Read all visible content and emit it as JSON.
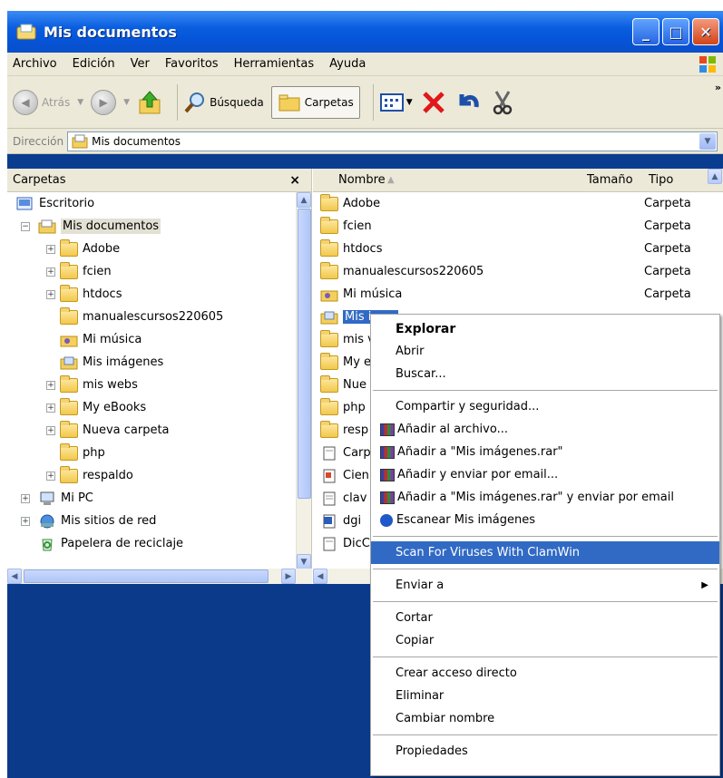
{
  "window": {
    "title": "Mis documentos"
  },
  "menu": [
    "Archivo",
    "Edición",
    "Ver",
    "Favoritos",
    "Herramientas",
    "Ayuda"
  ],
  "toolbar": {
    "back": "Atrás",
    "search": "Búsqueda",
    "folders": "Carpetas"
  },
  "address": {
    "label": "Dirección",
    "value": "Mis documentos"
  },
  "folders_pane": {
    "title": "Carpetas",
    "close": "×",
    "tree": [
      {
        "label": "Escritorio"
      },
      {
        "label": "Mis documentos"
      },
      {
        "label": "Adobe"
      },
      {
        "label": "fcien"
      },
      {
        "label": "htdocs"
      },
      {
        "label": "manualescursos220605"
      },
      {
        "label": "Mi música"
      },
      {
        "label": "Mis imágenes"
      },
      {
        "label": "mis webs"
      },
      {
        "label": "My eBooks"
      },
      {
        "label": "Nueva carpeta"
      },
      {
        "label": "php"
      },
      {
        "label": "respaldo"
      },
      {
        "label": "Mi PC"
      },
      {
        "label": "Mis sitios de red"
      },
      {
        "label": "Papelera de reciclaje"
      }
    ]
  },
  "files": {
    "columns": {
      "name": "Nombre",
      "size": "Tamaño",
      "type": "Tipo"
    },
    "rows": [
      {
        "name": "Adobe",
        "type": "Carpeta"
      },
      {
        "name": "fcien",
        "type": "Carpeta"
      },
      {
        "name": "htdocs",
        "type": "Carpeta"
      },
      {
        "name": "manualescursos220605",
        "type": "Carpeta"
      },
      {
        "name": "Mi música",
        "type": "Carpeta"
      },
      {
        "name": "Mis i",
        "type": ""
      },
      {
        "name": "mis v",
        "type": ""
      },
      {
        "name": "My e",
        "type": ""
      },
      {
        "name": "Nue",
        "type": ""
      },
      {
        "name": "php",
        "type": ""
      },
      {
        "name": "resp",
        "type": ""
      },
      {
        "name": "Carp",
        "type": ""
      },
      {
        "name": "Cien",
        "type": ""
      },
      {
        "name": "clav",
        "type": ""
      },
      {
        "name": "dgi",
        "type": ""
      },
      {
        "name": "DicC",
        "type": ""
      }
    ]
  },
  "context_menu": {
    "explore": "Explorar",
    "open": "Abrir",
    "search": "Buscar...",
    "share": "Compartir y seguridad...",
    "add_archive": "Añadir al archivo...",
    "add_rar": "Añadir a \"Mis imágenes.rar\"",
    "add_email": "Añadir y enviar por email...",
    "add_rar_email": "Añadir a \"Mis imágenes.rar\" y enviar por email",
    "scan": "Escanear Mis imágenes",
    "clamwin": "Scan For Viruses With ClamWin",
    "send_to": "Enviar a",
    "cut": "Cortar",
    "copy": "Copiar",
    "shortcut": "Crear acceso directo",
    "delete": "Eliminar",
    "rename": "Cambiar nombre",
    "properties": "Propiedades"
  }
}
